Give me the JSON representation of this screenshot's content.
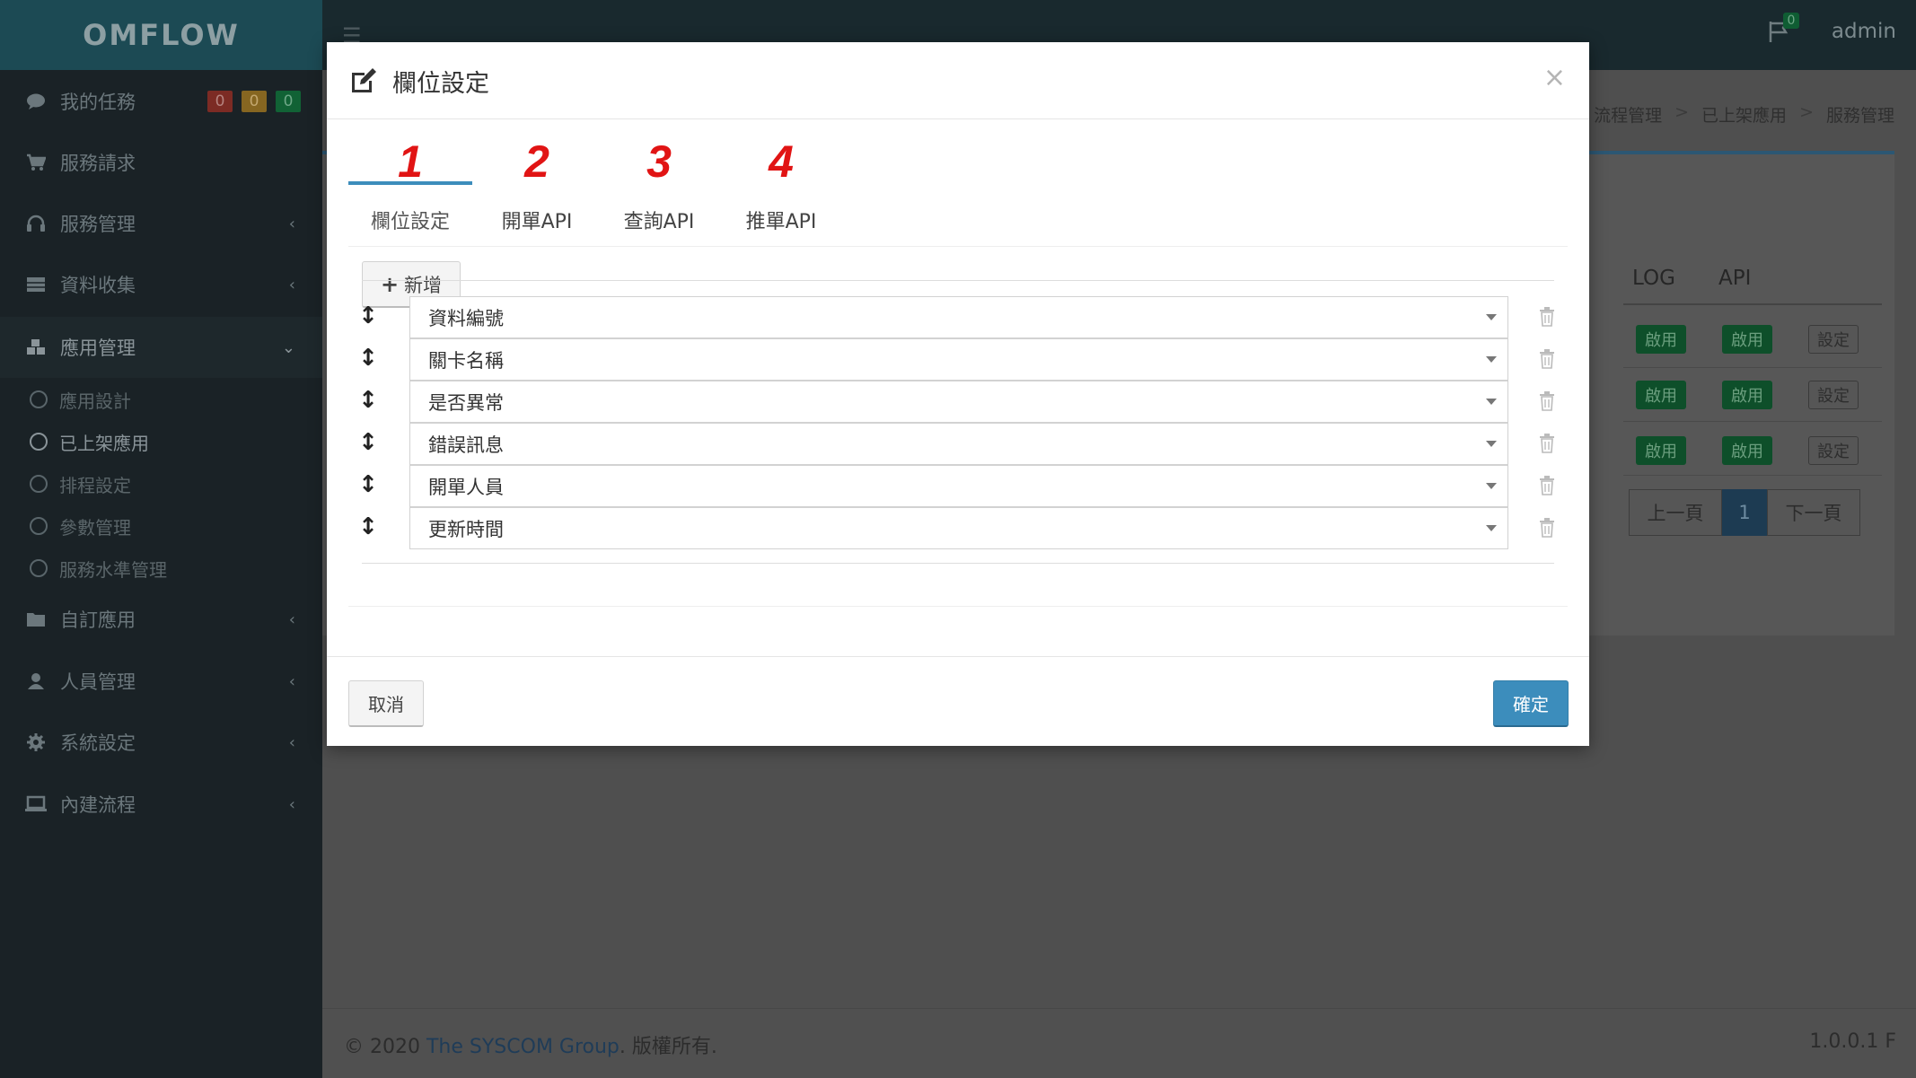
{
  "app": {
    "logo": "OMFLOW",
    "user": "admin",
    "notification_count": "0"
  },
  "sidebar": {
    "my_tasks": {
      "label": "我的任務",
      "badges": [
        "0",
        "0",
        "0"
      ]
    },
    "items": [
      {
        "label": "服務請求",
        "icon": "cart-icon"
      },
      {
        "label": "服務管理",
        "icon": "headset-icon"
      },
      {
        "label": "資料收集",
        "icon": "table-icon"
      },
      {
        "label": "應用管理",
        "icon": "cubes-icon"
      },
      {
        "label": "自訂應用",
        "icon": "folder-icon"
      },
      {
        "label": "人員管理",
        "icon": "user-icon"
      },
      {
        "label": "系統設定",
        "icon": "gear-icon"
      },
      {
        "label": "內建流程",
        "icon": "laptop-icon"
      }
    ],
    "sub_items": [
      "應用設計",
      "已上架應用",
      "排程設定",
      "參數管理",
      "服務水準管理"
    ]
  },
  "breadcrumb": [
    "流程管理",
    "已上架應用",
    "服務管理"
  ],
  "background_table": {
    "headers": [
      "LOG",
      "API"
    ],
    "rows": [
      {
        "log": "啟用",
        "api": "啟用",
        "action": "設定"
      },
      {
        "log": "啟用",
        "api": "啟用",
        "action": "設定"
      },
      {
        "log": "啟用",
        "api": "啟用",
        "action": "設定"
      }
    ],
    "pager": {
      "prev": "上一頁",
      "current": "1",
      "next": "下一頁"
    }
  },
  "footer": {
    "prefix": "© 2020 ",
    "company": "The SYSCOM Group",
    "suffix": ". 版權所有.",
    "version": "1.0.0.1 F"
  },
  "modal": {
    "title": "欄位設定",
    "close": "×",
    "tabs": [
      {
        "number": "1",
        "label": "欄位設定"
      },
      {
        "number": "2",
        "label": "開單API"
      },
      {
        "number": "3",
        "label": "查詢API"
      },
      {
        "number": "4",
        "label": "推單API"
      }
    ],
    "add_button": "新增",
    "fields": [
      "資料編號",
      "關卡名稱",
      "是否異常",
      "錯誤訊息",
      "開單人員",
      "更新時間"
    ],
    "cancel": "取消",
    "confirm": "確定"
  }
}
